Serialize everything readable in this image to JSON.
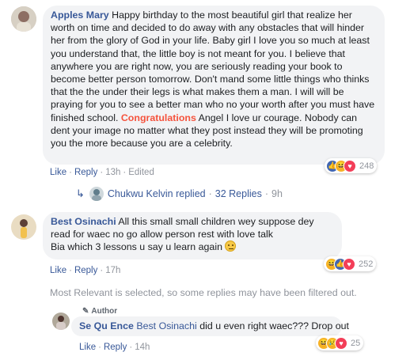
{
  "comments": {
    "first": {
      "author": "Apples Mary",
      "text_before": " Happy birthday to the most beautiful girl that realize her worth on time and decided to do away with any obstacles that will hinder her from the glory of God in your life. Baby girl I love you so much at least you understand that, the little boy is not meant for you. I believe that anywhere you are right now, you are seriously reading your book to become better person tomorrow. Don't mand some little things who thinks that the the under their legs is what makes them a man. I will will be praying for you to see a better man who no your worth after you must have finished school. ",
      "highlight": "Congratulations",
      "text_after": " Angel I love ur courage. Nobody can dent your image no matter what they post instead they will be promoting you the more because you are a celebrity.",
      "like_label": "Like",
      "reply_label": "Reply",
      "time": "13h",
      "edited": "Edited",
      "reaction_count": "248",
      "reactions": [
        "like-icon",
        "haha-icon",
        "love-icon"
      ]
    },
    "replies_summary": {
      "replier": "Chukwu Kelvin",
      "replied": "replied",
      "count": "32 Replies",
      "time": "9h"
    },
    "second": {
      "author": "Best Osinachi",
      "line1": " All this small small children wey suppose dey read for waec no go allow person rest with love talk",
      "line2": "Bia which 3 lessons u say u learn again",
      "emoji": "thinking-face",
      "like_label": "Like",
      "reply_label": "Reply",
      "time": "17h",
      "reaction_count": "252",
      "reactions": [
        "haha-icon",
        "like-icon",
        "love-icon"
      ]
    },
    "filter_notice": "Most Relevant is selected, so some replies may have been filtered out.",
    "reply": {
      "badge": "Author",
      "author": "Se Qu Ence",
      "mention": "Best Osinachi",
      "text": " did u even right waec??? Drop out",
      "like_label": "Like",
      "reply_label": "Reply",
      "time": "14h",
      "reaction_count": "25",
      "reactions": [
        "haha-icon",
        "sad-icon",
        "love-icon"
      ]
    }
  }
}
